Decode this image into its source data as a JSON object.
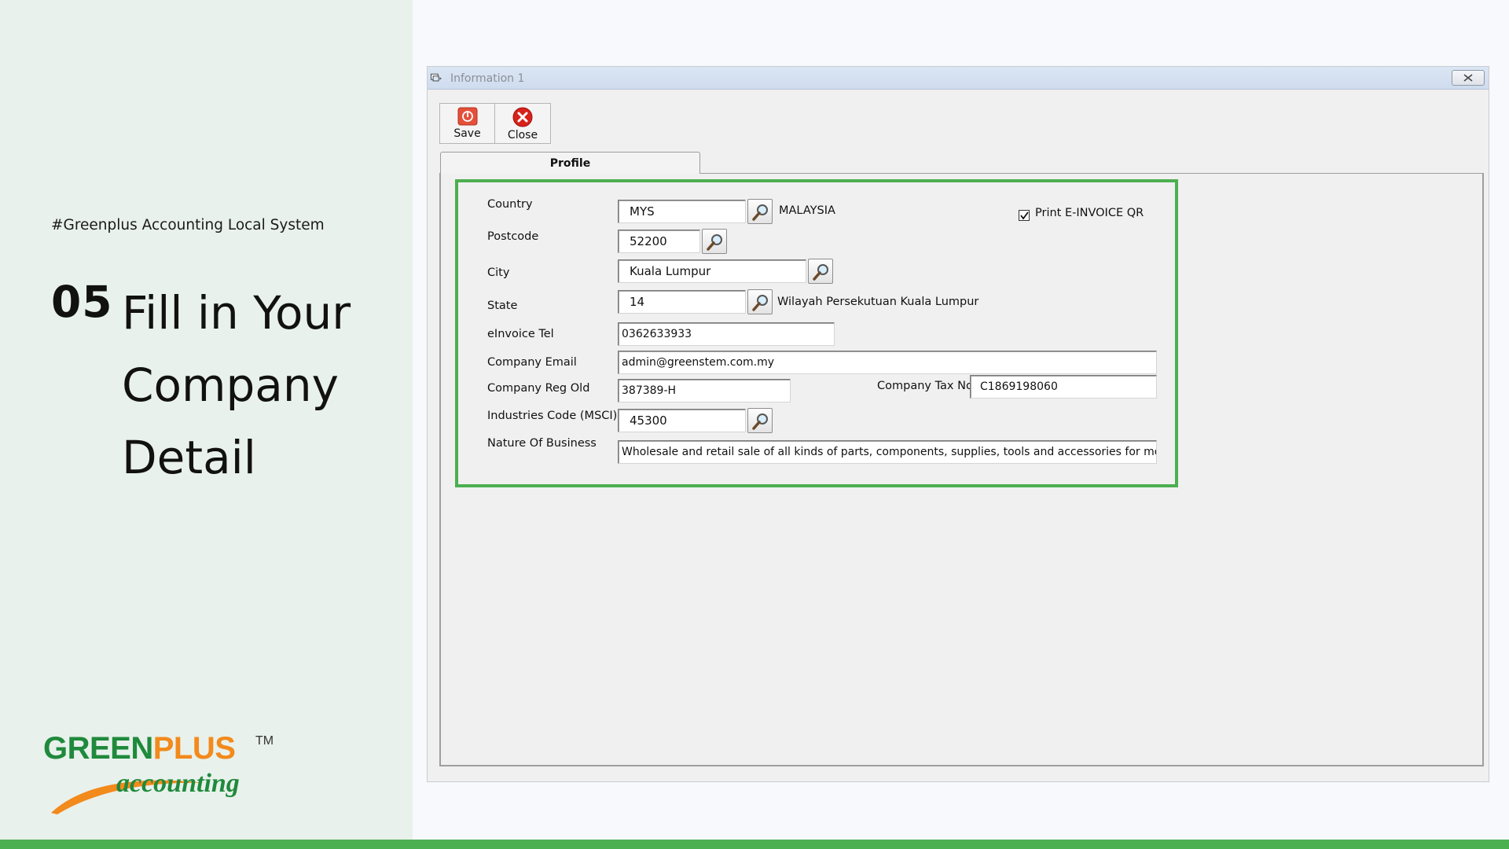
{
  "slide": {
    "tagline": "#Greenplus Accounting Local System",
    "step_number": "05",
    "title_lines": [
      "Fill in Your",
      "Company",
      "Detail"
    ],
    "logo": {
      "brand_green": "GREEN",
      "brand_orange": "PLUS",
      "trademark": "TM",
      "sub": "accounting"
    },
    "colors": {
      "accent_green": "#4caf50",
      "brand_green": "#1f8a3c",
      "brand_orange": "#f28a1c"
    }
  },
  "window": {
    "title": "Information 1",
    "toolbar": {
      "save_label": "Save",
      "close_label": "Close"
    },
    "tabs": [
      {
        "label": "Profile",
        "selected": true
      }
    ],
    "form": {
      "country": {
        "label": "Country",
        "value": "MYS",
        "description": "MALAYSIA"
      },
      "postcode": {
        "label": "Postcode",
        "value": "52200"
      },
      "city": {
        "label": "City",
        "value": "Kuala Lumpur"
      },
      "state": {
        "label": "State",
        "value": "14",
        "description": "Wilayah Persekutuan Kuala Lumpur"
      },
      "einvoice_tel": {
        "label": "eInvoice Tel",
        "value": "0362633933"
      },
      "company_email": {
        "label": "Company Email",
        "value": "admin@greenstem.com.my"
      },
      "company_reg_old": {
        "label": "Company Reg Old",
        "value": "387389-H"
      },
      "company_tax_no": {
        "label": "Company Tax No",
        "value": "C1869198060"
      },
      "industries_code": {
        "label": "Industries Code (MSCI)",
        "value": "45300"
      },
      "nature_of_business": {
        "label": "Nature Of Business",
        "value": "Wholesale and retail sale of all kinds of parts, components, supplies, tools and accessories for motor vehi"
      },
      "print_einvoice_qr": {
        "label": "Print E-INVOICE QR",
        "checked": true
      }
    }
  }
}
